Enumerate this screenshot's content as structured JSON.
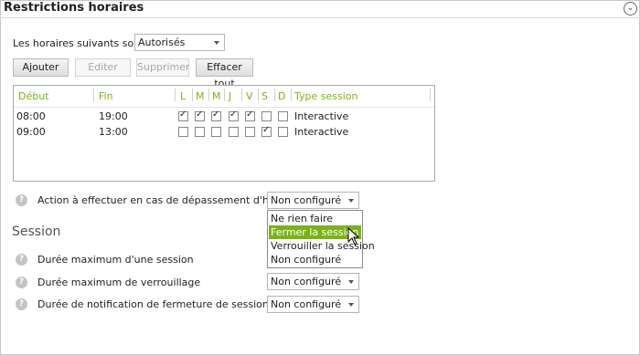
{
  "header": {
    "title": "Restrictions horaires"
  },
  "mode": {
    "label": "Les horaires suivants sont",
    "value": "Autorisés"
  },
  "toolbar": {
    "add": "Ajouter",
    "edit": "Editer",
    "delete": "Supprimer",
    "clear": "Effacer tout"
  },
  "grid": {
    "columns": {
      "start": "Début",
      "end": "Fin",
      "d1": "L",
      "d2": "M",
      "d3": "M",
      "d4": "J",
      "d5": "V",
      "d6": "S",
      "d7": "D",
      "type": "Type session"
    },
    "rows": [
      {
        "start": "08:00",
        "end": "19:00",
        "days": [
          true,
          true,
          true,
          true,
          true,
          false,
          false
        ],
        "type": "Interactive"
      },
      {
        "start": "09:00",
        "end": "13:00",
        "days": [
          false,
          false,
          false,
          false,
          false,
          true,
          false
        ],
        "type": "Interactive"
      }
    ]
  },
  "action": {
    "label": "Action à effectuer en cas de dépassement d'horaire",
    "value": "Non configuré",
    "options": [
      "Ne rien faire",
      "Fermer la session",
      "Verrouiller la session",
      "Non configuré"
    ],
    "highlighted": "Fermer la session"
  },
  "session": {
    "title": "Session",
    "max_duration": {
      "label": "Durée maximum d'une session"
    },
    "max_lock": {
      "label": "Durée maximum de verrouillage",
      "value": "Non configuré"
    },
    "notify": {
      "label": "Durée de notification de fermeture de session",
      "value": "Non configuré"
    }
  },
  "colors": {
    "accent": "#7ab317"
  },
  "icons": {
    "help": "help-circle-icon",
    "collapse": "chevron-down-icon",
    "pointer": "mouse-pointer-icon"
  }
}
